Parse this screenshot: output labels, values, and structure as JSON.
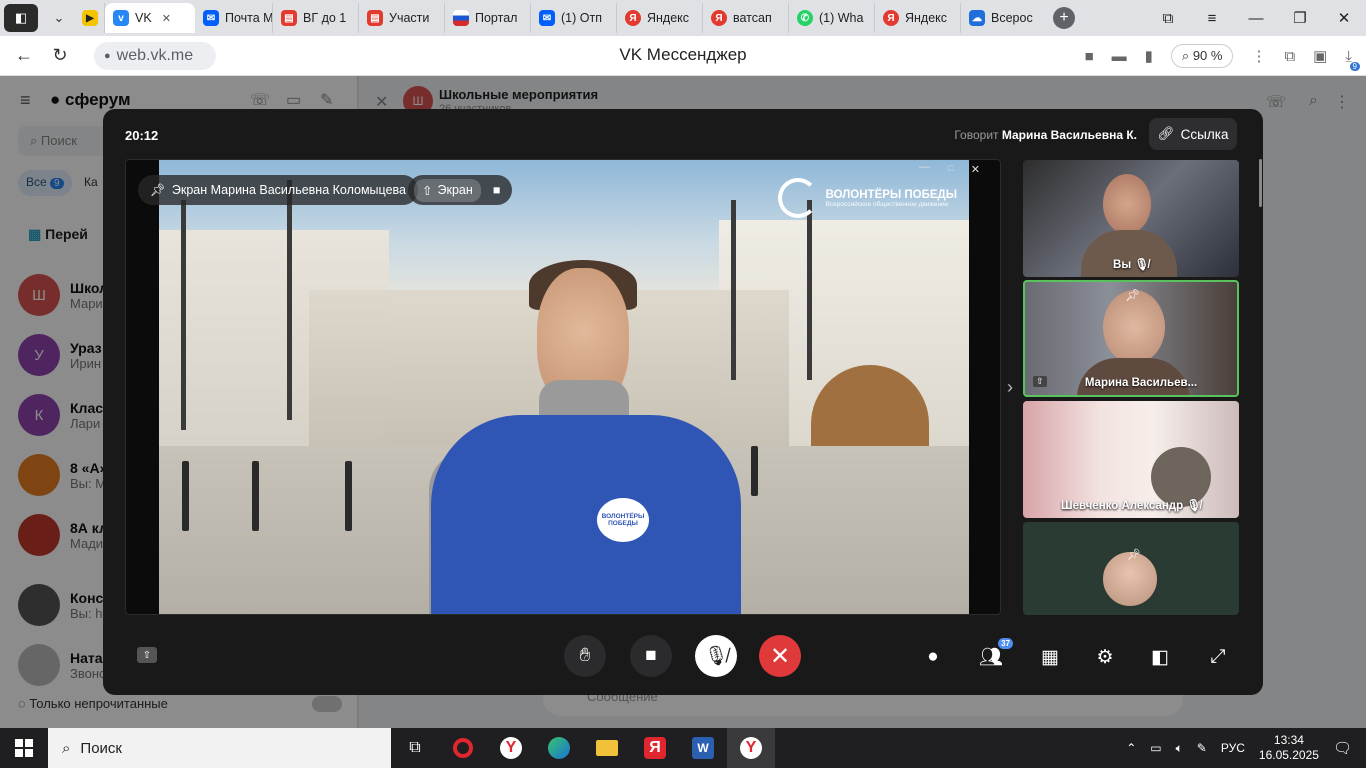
{
  "browser": {
    "tabs": [
      {
        "label": "VK",
        "color": "#2787f5",
        "icon": "vk-icon"
      },
      {
        "label": "Почта M",
        "color": "#005ff9",
        "icon": "mail-icon"
      },
      {
        "label": "ВГ до 1",
        "color": "#e23a2e",
        "icon": "doc-icon"
      },
      {
        "label": "Участи",
        "color": "#e23a2e",
        "icon": "doc-icon"
      },
      {
        "label": "Портал",
        "color": "#c62b2b",
        "icon": "flag-icon"
      },
      {
        "label": "(1) Отп",
        "color": "#005ff9",
        "icon": "mail-icon"
      },
      {
        "label": "Яндекс",
        "color": "#e23a2e",
        "icon": "yandex-icon"
      },
      {
        "label": "ватсап",
        "color": "#e23a2e",
        "icon": "yandex-icon"
      },
      {
        "label": "(1) Wha",
        "color": "#25d366",
        "icon": "whatsapp-icon"
      },
      {
        "label": "Яндекс",
        "color": "#e23a2e",
        "icon": "yandex-icon"
      },
      {
        "label": "Всерос",
        "color": "#1e6fd9",
        "icon": "cloud-icon"
      }
    ],
    "url": "web.vk.me",
    "page_title": "VK Мессенджер",
    "zoom": "90 %",
    "downloads_count": "9"
  },
  "vk": {
    "brand": "сферум",
    "search_placeholder": "Поиск",
    "filter_all": "Все",
    "filter_all_count": "9",
    "filter_next": "Ка",
    "section": "Перей",
    "chats": [
      {
        "letter": "Ш",
        "name": "Школ",
        "sub": "Мари",
        "color": "#d9534f"
      },
      {
        "letter": "У",
        "name": "Ураз",
        "sub": "Ирин",
        "color": "#8e44ad"
      },
      {
        "letter": "К",
        "name": "Клас",
        "sub": "Лари",
        "color": "#8e44ad"
      },
      {
        "letter": "",
        "name": "8 «А»",
        "sub": "Вы: М",
        "color": "#e67e22"
      },
      {
        "letter": "",
        "name": "8А кл",
        "sub": "Мади",
        "color": "#c0392b"
      },
      {
        "letter": "",
        "name": "Конс",
        "sub": "Вы: h",
        "color": "#555"
      },
      {
        "letter": "",
        "name": "Ната",
        "sub": "Звонс",
        "color": "#bbb"
      }
    ],
    "unread_only": "Только непрочитанные",
    "open_chat_letter": "Ш",
    "open_chat_title": "Школьные мероприятия",
    "open_chat_sub": "26 участников",
    "message_placeholder": "Сообщение"
  },
  "call": {
    "time": "20:12",
    "speaking_prefix": "Говорит",
    "speaking_name": "Марина Васильевна К.",
    "link_label": "Ссылка",
    "screen_chip": "Экран Марина Васильевна Коломыцева",
    "screen_tag": "Экран",
    "watermark_title": "ВОЛОНТЁРЫ ПОБЕДЫ",
    "watermark_sub": "Всероссийское общественное движение",
    "badge_text": "ВОЛОНТЁРЫ ПОБЕДЫ",
    "participants": [
      {
        "label": "Вы",
        "muted": true,
        "selected": false
      },
      {
        "label": "Марина Васильев...",
        "muted": false,
        "selected": true
      },
      {
        "label": "Шевченко Александр",
        "muted": true,
        "selected": false
      },
      {
        "label": "",
        "muted": false,
        "selected": false
      }
    ],
    "participants_count": "37"
  },
  "taskbar": {
    "search_label": "Поиск",
    "lang": "РУС",
    "time": "13:34",
    "date": "16.05.2025"
  }
}
